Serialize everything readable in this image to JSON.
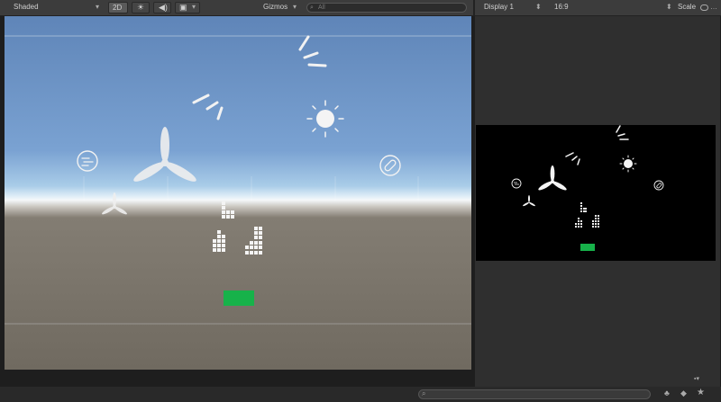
{
  "scene_toolbar": {
    "shading_mode": "Shaded",
    "mode_2d_label": "2D",
    "gizmos_label": "Gizmos",
    "search_placeholder": "All"
  },
  "game_toolbar": {
    "display_label": "Display 1",
    "aspect_label": "16:9",
    "scale_label": "Scale"
  },
  "colors": {
    "button_green": "#17b24a",
    "icon_white": "#eeeeee",
    "sky_top": "#5f85b8",
    "ground": "#706a60"
  },
  "scene_objects": {
    "icons": [
      "propeller-icon",
      "sun-icon",
      "wind-lines-icon",
      "bandage-icon",
      "cloud-wind-icon",
      "building-icon",
      "green-button"
    ]
  }
}
